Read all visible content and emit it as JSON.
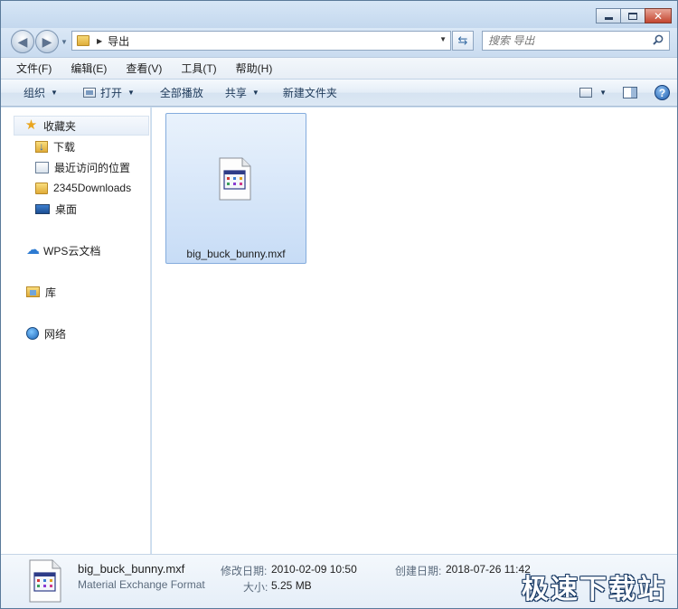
{
  "window": {
    "caption_buttons": [
      "minimize-icon",
      "maximize-icon",
      "close-icon"
    ]
  },
  "address": {
    "crumb": "导出"
  },
  "search": {
    "placeholder": "搜索 导出"
  },
  "menu": [
    "文件(F)",
    "编辑(E)",
    "查看(V)",
    "工具(T)",
    "帮助(H)"
  ],
  "toolbar": {
    "organize": "组织",
    "open": "打开",
    "play_all": "全部播放",
    "share": "共享",
    "new_folder": "新建文件夹"
  },
  "nav": {
    "favorites": "收藏夹",
    "downloads": "下载",
    "recent": "最近访问的位置",
    "downloads2345": "2345Downloads",
    "desktop": "桌面",
    "wps": "WPS云文档",
    "library": "库",
    "network": "网络"
  },
  "files": [
    {
      "name": "big_buck_bunny.mxf"
    }
  ],
  "details": {
    "name": "big_buck_bunny.mxf",
    "type": "Material Exchange Format",
    "modified_label": "修改日期:",
    "modified": "2010-02-09 10:50",
    "created_label": "创建日期:",
    "created": "2018-07-26 11:42",
    "size_label": "大小:",
    "size": "5.25 MB"
  },
  "watermark": "极速下载站",
  "colors": {
    "selection": "#c7dcf6",
    "chrome": "#c9dcef",
    "accent": "#1f5fb0"
  }
}
